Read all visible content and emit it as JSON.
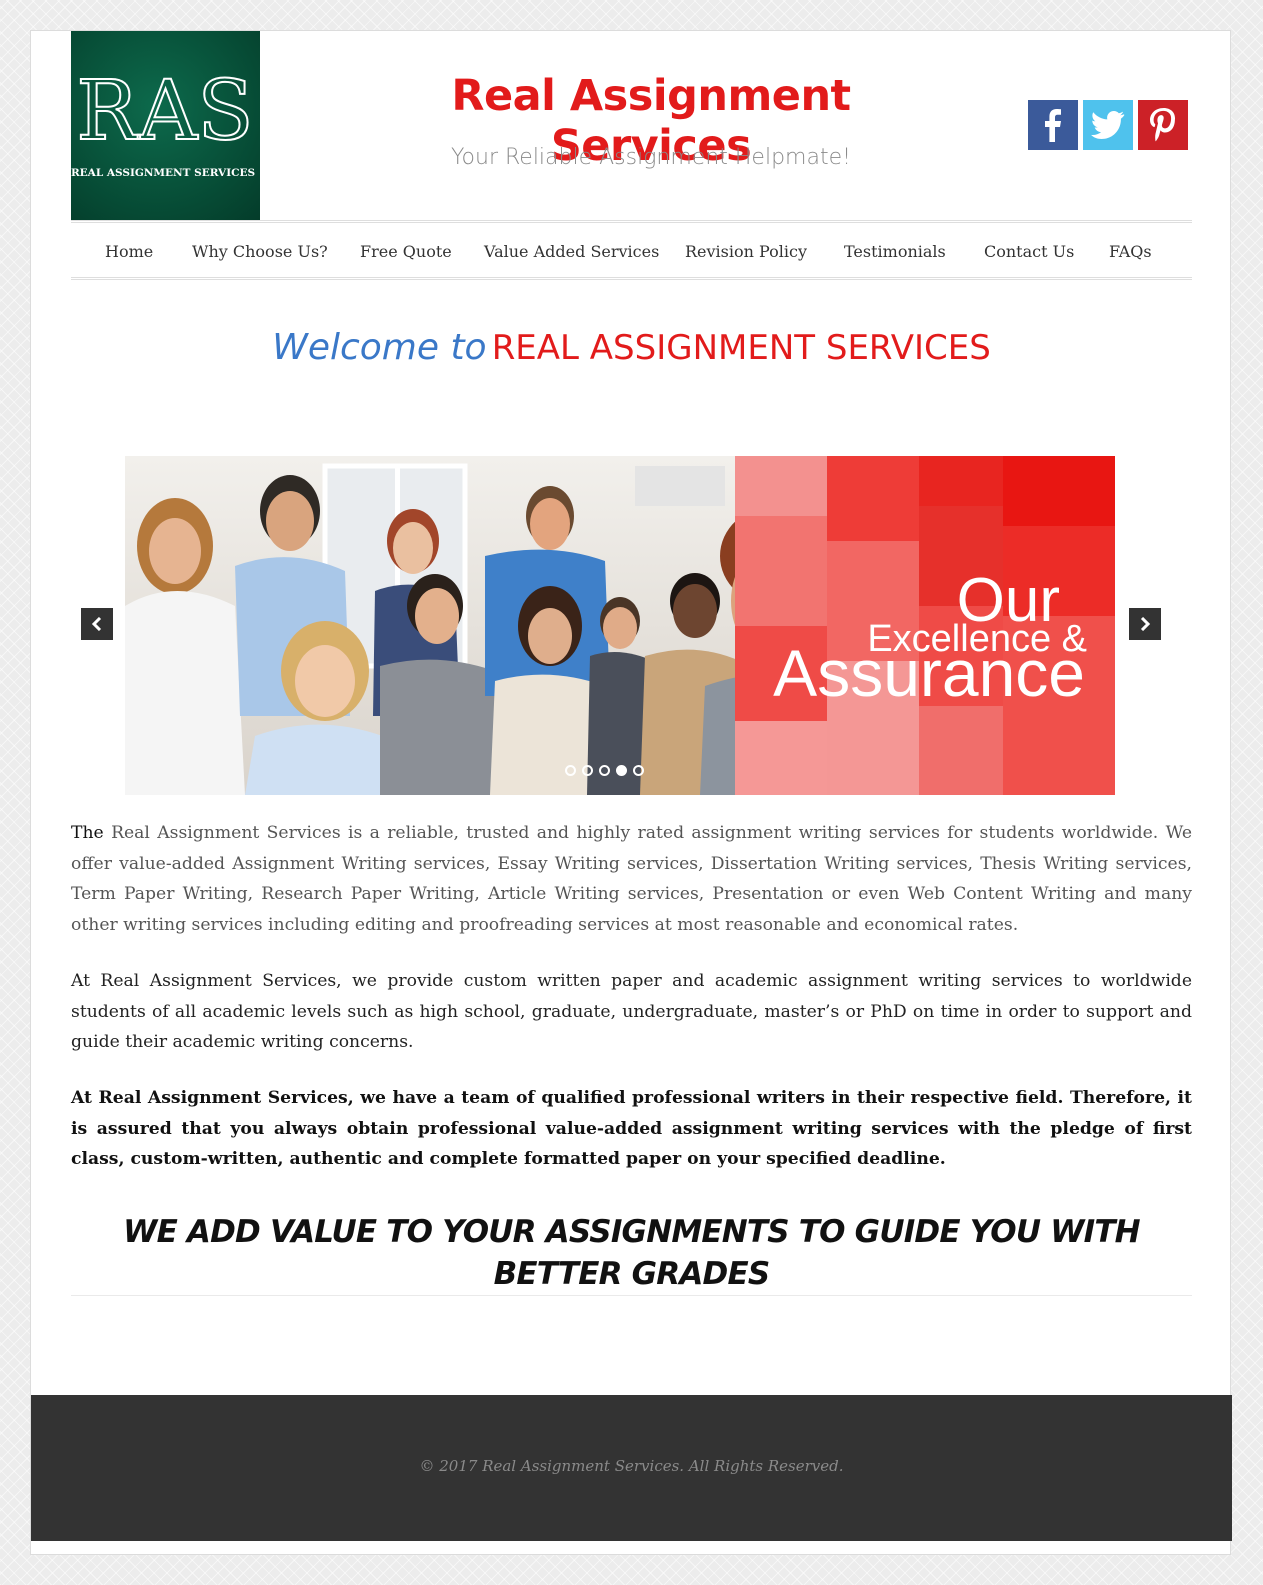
{
  "logo": {
    "monogram": "RAS",
    "caption": "REAL ASSIGNMENT SERVICES"
  },
  "header": {
    "title": "Real Assignment Services",
    "tagline": "Your Reliable Assignment Helpmate!"
  },
  "social": [
    "facebook-icon",
    "twitter-icon",
    "pinterest-icon"
  ],
  "nav": {
    "items": [
      {
        "label": "Home"
      },
      {
        "label": "Why Choose Us?"
      },
      {
        "label": "Free Quote"
      },
      {
        "label": "Value Added Services"
      },
      {
        "label": "Revision Policy"
      },
      {
        "label": "Testimonials"
      },
      {
        "label": "Contact Us"
      },
      {
        "label": "FAQs"
      }
    ]
  },
  "welcome": {
    "prefix": "Welcome to",
    "name": "REAL ASSIGNMENT SERVICES"
  },
  "slider": {
    "caption_line1": "Our",
    "caption_line2": "Excellence &",
    "caption_line3": "Assurance",
    "dots_total": 5,
    "active_dot": 4
  },
  "content": {
    "p1_lead": "The",
    "p1_rest": "Real Assignment Services is a reliable, trusted and highly rated assignment writing services for students worldwide. We offer value-added Assignment Writing services, Essay Writing services, Dissertation Writing services, Thesis Writing services, Term Paper Writing, Research Paper Writing, Article Writing services, Presentation or even Web Content Writing and many other writing services including editing and proofreading services at most reasonable and economical rates.",
    "p2": "At Real Assignment Services, we provide custom written paper and academic assignment writing services to worldwide students of all academic levels such as high school, graduate, undergraduate, master’s or PhD on time in order to support and guide their academic writing concerns.",
    "p3": "At Real Assignment Services, we have a team of qualified professional writers in their respective field. Therefore, it is assured that you always obtain professional value-added assignment writing services with the pledge of first class, custom-written, authentic and complete formatted paper on your specified deadline.",
    "heading": "WE ADD VALUE TO YOUR ASSIGNMENTS TO GUIDE YOU WITH BETTER GRADES"
  },
  "footer": {
    "copyright": "© 2017 Real Assignment Services. All Rights Reserved."
  },
  "colors": {
    "brand_red": "#e21b1b",
    "welcome_blue": "#3a78c8",
    "logo_green": "#064a34",
    "footer_bg": "#333333"
  }
}
